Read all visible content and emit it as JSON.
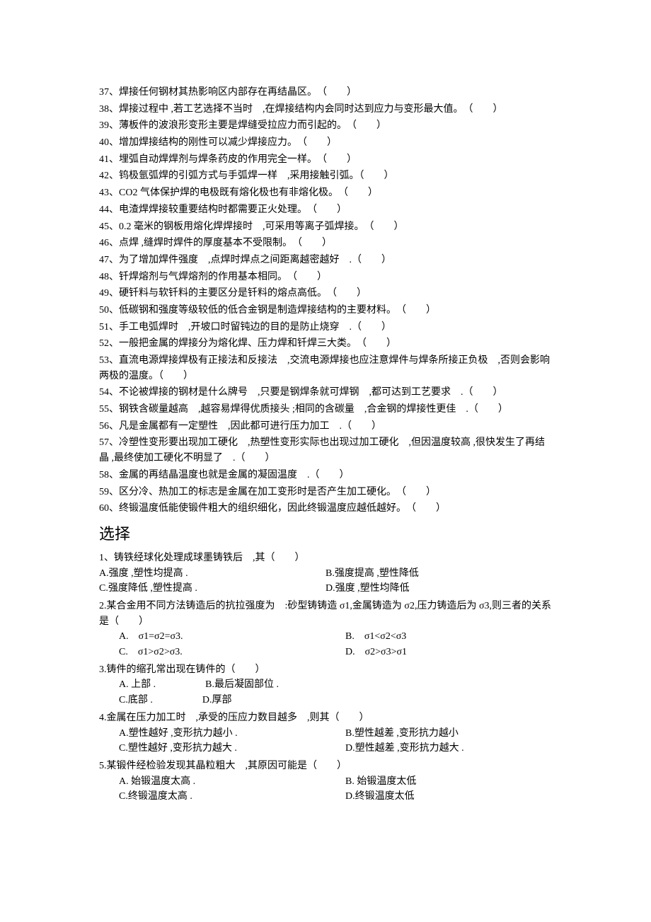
{
  "tf": [
    {
      "n": "37",
      "text": "焊接任何钢材其热影响区内部存在再结晶区。　（　　）"
    },
    {
      "n": "38",
      "text": "焊接过程中 ,若工艺选择不当时　,在焊接结构内会同时达到应力与变形最大值。　（　　）"
    },
    {
      "n": "39",
      "text": "薄板件的波浪形变形主要是焊缝受拉应力而引起的。　（　　）"
    },
    {
      "n": "40",
      "text": "增加焊接结构的刚性可以减少焊接应力。　（　　）"
    },
    {
      "n": "41",
      "text": "埋弧自动焊焊剂与焊条药皮的作用完全一样。　（　　）"
    },
    {
      "n": "42",
      "text": "钨极氩弧焊的引弧方式与手弧焊一样　,采用接触引弧。（　　）"
    },
    {
      "n": "43",
      "text": "CO2 气体保护焊的电极既有熔化极也有非熔化极。　（　　）"
    },
    {
      "n": "44",
      "text": "电渣焊焊接较重要结构时都需要正火处理。　（　　）"
    },
    {
      "n": "45",
      "text": "0.2 毫米的钢板用熔化焊焊接时　,可采用等离子弧焊接。　（　　）"
    },
    {
      "n": "46",
      "text": "点焊 ,缝焊时焊件的厚度基本不受限制。　（　　）"
    },
    {
      "n": "47",
      "text": "为了增加焊件强度　,点焊时焊点之间距离越密越好　.（　　）"
    },
    {
      "n": "48",
      "text": "钎焊熔剂与气焊熔剂的作用基本相同。　（　　）"
    },
    {
      "n": "49",
      "text": "硬钎料与软钎料的主要区分是钎料的熔点高低。　（　　）"
    },
    {
      "n": "50",
      "text": "低碳钢和强度等级较低的低合金钢是制造焊接结构的主要材料。　（　　）"
    },
    {
      "n": "51",
      "text": "手工电弧焊时　,开坡口时留钝边的目的是防止烧穿　.（　　）"
    },
    {
      "n": "52",
      "text": "一般把金属的焊接分为熔化焊、压力焊和钎焊三大类。　（　　）"
    },
    {
      "n": "53",
      "text": "直流电源焊接焊极有正接法和反接法　,交流电源焊接也应注意焊件与焊条所接正负极　,否则会影响两极的温度。（　　）"
    },
    {
      "n": "54",
      "text": "不论被焊接的钢材是什么牌号　,只要是钢焊条就可焊钢　,都可达到工艺要求　.（　　）"
    },
    {
      "n": "55",
      "text": "钢铁含碳量越高　,越容易焊得优质接头 ;相同的含碳量　,合金钢的焊接性更佳　.（　　）"
    },
    {
      "n": "56",
      "text": "凡是金属都有一定塑性　,因此都可进行压力加工　.（　　）"
    },
    {
      "n": "57",
      "text": "冷塑性变形要出现加工硬化　,热塑性变形实际也出现过加工硬化　,但因温度较高 ,很快发生了再结晶 ,最终使加工硬化不明显了　.（　　）"
    },
    {
      "n": "58",
      "text": "金属的再结晶温度也就是金属的凝固温度　.（　　）"
    },
    {
      "n": "59",
      "text": "区分冷、热加工的标志是金属在加工变形时是否产生加工硬化。　（　　）"
    },
    {
      "n": "60",
      "text": "终锻温度低能使锻件粗大的组织细化，因此终锻温度应越低越好。　（　　）"
    }
  ],
  "sectionTitle": "选择",
  "mc": [
    {
      "stem": "1、铸铁经球化处理成球墨铸铁后　,其（　　）",
      "indent": false,
      "opts": [
        "A.强度 ,塑性均提高 .",
        "B.强度提高 ,塑性降低",
        "C.强度降低 ,塑性提高 .",
        "D.强度 ,塑性均降低"
      ]
    },
    {
      "stem": "2.某合金用不同方法铸造后的抗拉强度为　:砂型铸铸造 σ1,金属铸造为 σ2,压力铸造后为 σ3,则三者的关系是（　　）",
      "indent": true,
      "opts": [
        "A.　σ1=σ2=σ3.",
        "B.　σ1<σ2<σ3",
        "C.　σ1>σ2>σ3.",
        "D.　σ2>σ3>σ1"
      ]
    },
    {
      "stem": "3.铸件的缩孔常出现在铸件的（　　）",
      "indent": true,
      "opts": [
        "A. 上部 .　　　　　B.最后凝固部位 .",
        "C.底部 .　　　　　D.厚部"
      ],
      "fullRows": true
    },
    {
      "stem": "4.金属在压力加工时　,承受的压应力数目越多　,则其（　　）",
      "indent": true,
      "opts": [
        "A.塑性越好 ,变形抗力越小 .",
        "B.塑性越差 ,变形抗力越小",
        "C.塑性越好 ,变形抗力越大 .",
        "D.塑性越差 ,变形抗力越大 ."
      ]
    },
    {
      "stem": "5.某锻件经检验发现其晶粒粗大　,其原因可能是（　　）",
      "indent": true,
      "opts": [
        "A. 始锻温度太高 .",
        "B. 始锻温度太低",
        "C.终锻温度太高 .",
        "D.终锻温度太低"
      ]
    }
  ]
}
